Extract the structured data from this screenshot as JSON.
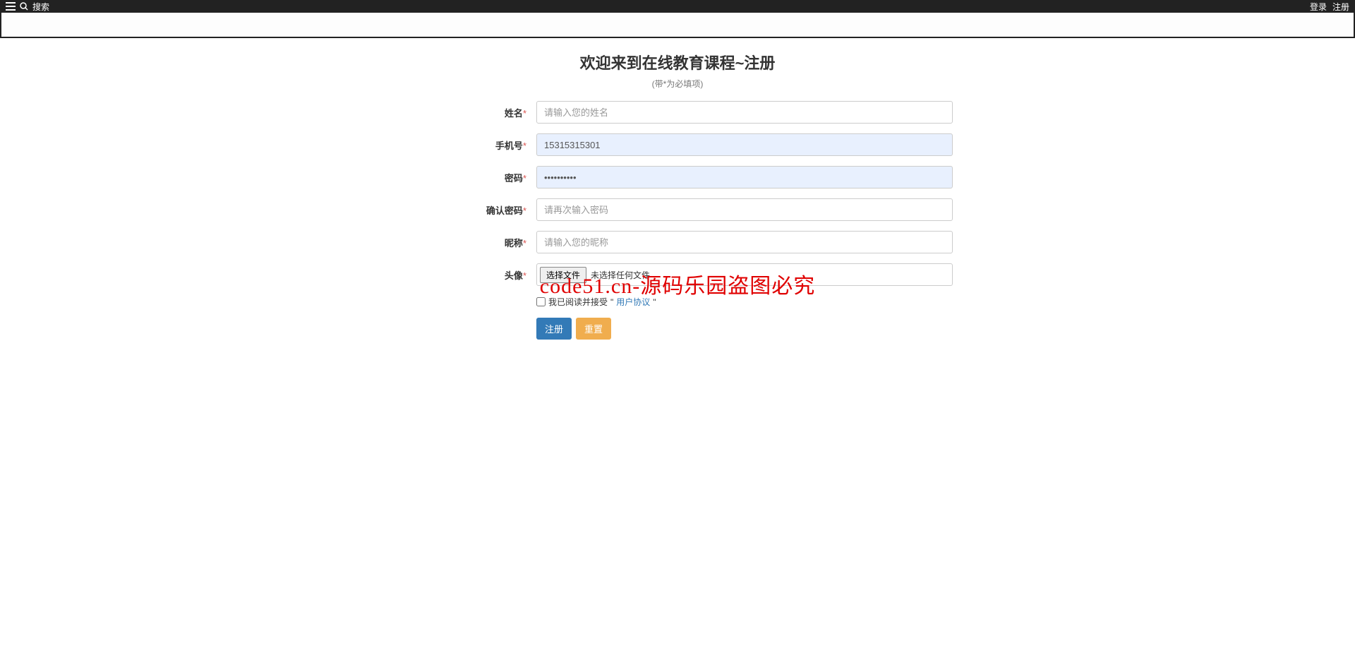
{
  "navbar": {
    "search_label": "搜索",
    "login_label": "登录",
    "register_label": "注册"
  },
  "page": {
    "title": "欢迎来到在线教育课程~注册",
    "subtitle": "(带*为必填项)"
  },
  "form": {
    "name": {
      "label": "姓名",
      "placeholder": "请输入您的姓名",
      "value": ""
    },
    "phone": {
      "label": "手机号",
      "placeholder": "",
      "value": "15315315301"
    },
    "password": {
      "label": "密码",
      "placeholder": "",
      "value": "••••••••••"
    },
    "confirm_password": {
      "label": "确认密码",
      "placeholder": "请再次输入密码",
      "value": ""
    },
    "nickname": {
      "label": "昵称",
      "placeholder": "请输入您的昵称",
      "value": ""
    },
    "avatar": {
      "label": "头像",
      "button_text": "选择文件",
      "no_file_text": "未选择任何文件"
    },
    "agreement": {
      "text": "我已阅读并接受",
      "link_prefix": "\"",
      "link_text": "用户协议",
      "link_suffix": "\""
    },
    "buttons": {
      "submit": "注册",
      "reset": "重置"
    }
  },
  "watermark": "code51.cn-源码乐园盗图必究"
}
